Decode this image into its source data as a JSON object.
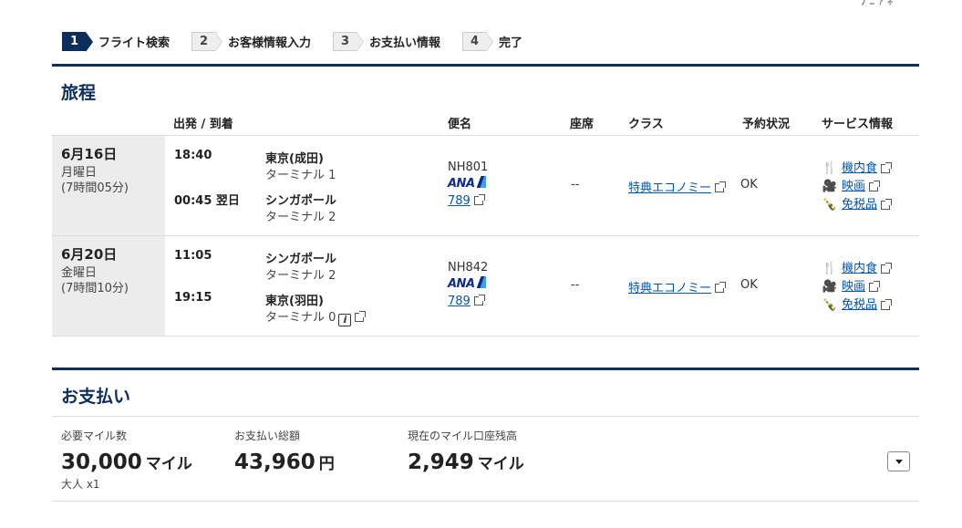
{
  "top_fragment": "ﾌ ﾆ ｧ ﾈﾟ",
  "stepper": [
    {
      "num": "1",
      "label": "フライト検索",
      "active": true
    },
    {
      "num": "2",
      "label": "お客様情報入力",
      "active": false
    },
    {
      "num": "3",
      "label": "お支払い情報",
      "active": false
    },
    {
      "num": "4",
      "label": "完了",
      "active": false
    }
  ],
  "itinerary": {
    "title": "旅程",
    "headers": {
      "dep_arr": "出発 / 到着",
      "flight": "便名",
      "seat": "座席",
      "class": "クラス",
      "status": "予約状況",
      "service": "サービス情報"
    },
    "rows": [
      {
        "date": "6月16日",
        "weekday": "月曜日",
        "duration": "(7時間05分)",
        "dep_time": "18:40",
        "dep_city": "東京(成田)",
        "dep_terminal": "ターミナル 1",
        "arr_time": "00:45 翌日",
        "arr_city": "シンガポール",
        "arr_terminal": "ターミナル 2",
        "flight_no": "NH801",
        "airline": "ANA",
        "aircraft": "789",
        "seat": "--",
        "class": "特典エコノミー",
        "status": "OK",
        "services": [
          "機内食",
          "映画",
          "免税品"
        ]
      },
      {
        "date": "6月20日",
        "weekday": "金曜日",
        "duration": "(7時間10分)",
        "dep_time": "11:05",
        "dep_city": "シンガポール",
        "dep_terminal": "ターミナル 2",
        "arr_time": "19:15",
        "arr_city": "東京(羽田)",
        "arr_terminal": "ターミナル 0",
        "flight_no": "NH842",
        "airline": "ANA",
        "aircraft": "789",
        "seat": "--",
        "class": "特典エコノミー",
        "status": "OK",
        "services": [
          "機内食",
          "映画",
          "免税品"
        ]
      }
    ]
  },
  "payment": {
    "title": "お支払い",
    "miles_label": "必要マイル数",
    "miles_value": "30,000",
    "miles_unit": "マイル",
    "passengers": "大人 x1",
    "total_label": "お支払い総額",
    "total_value": "43,960",
    "total_unit": "円",
    "balance_label": "現在のマイル口座残高",
    "balance_value": "2,949",
    "balance_unit": "マイル"
  },
  "colors": {
    "navy": "#0d2d5c",
    "link": "#0056b3"
  },
  "icons": {
    "meal": "meal-icon",
    "movie": "movie-icon",
    "dutyfree": "dutyfree-icon",
    "external": "external-link-icon",
    "info": "info-icon",
    "dropdown": "chevron-down-icon"
  }
}
